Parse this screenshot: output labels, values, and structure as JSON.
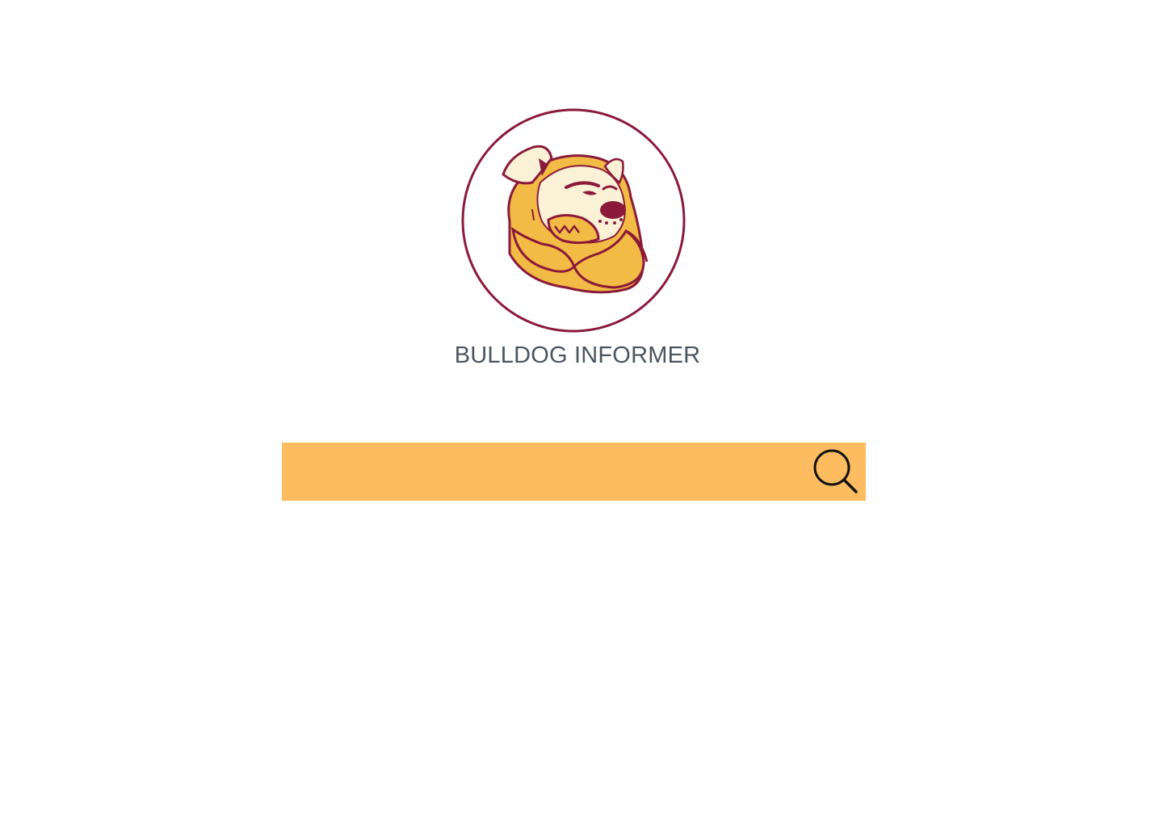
{
  "site": {
    "title": "BULLDOG INFORMER"
  },
  "logo": {
    "icon": "bulldog-mascot",
    "colors": {
      "maroon": "#8b1a3a",
      "gold": "#f2bb45",
      "cream": "#f9ecc8"
    }
  },
  "search": {
    "value": "",
    "placeholder": "",
    "icon": "search-icon",
    "bar_color": "#fdbc5f"
  }
}
